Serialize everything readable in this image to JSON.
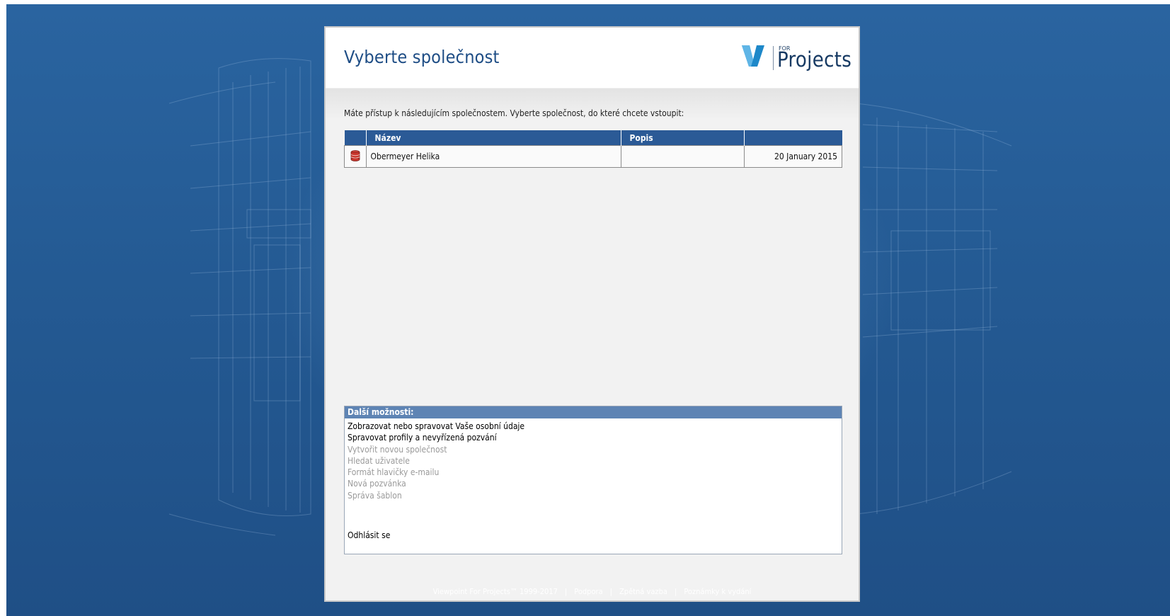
{
  "header": {
    "title": "Vyberte společnost",
    "logo": {
      "for_text": "FOR",
      "word": "Projects",
      "mark_color": "#1e88c9",
      "mark_accent": "#9fd0ee"
    }
  },
  "intro_text": "Máte přístup k následujícím společnostem. Vyberte společnost, do které chcete vstoupit:",
  "companies_table": {
    "columns": [
      "",
      "Název",
      "Popis",
      ""
    ],
    "rows": [
      {
        "icon": "database-icon",
        "name": "Obermeyer Helika",
        "description": "",
        "date": "20 January 2015"
      }
    ]
  },
  "more_options": {
    "title": "Další možnosti:",
    "items": [
      {
        "label": "Zobrazovat nebo spravovat Vaše osobní údaje",
        "enabled": true
      },
      {
        "label": "Spravovat profily a nevyřízená pozvání",
        "enabled": true
      },
      {
        "label": "Vytvořit novou společnost",
        "enabled": false
      },
      {
        "label": "Hledat uživatele",
        "enabled": false
      },
      {
        "label": "Formát hlavičky e-mailu",
        "enabled": false
      },
      {
        "label": "Nová pozvánka",
        "enabled": false
      },
      {
        "label": "Správa šablon",
        "enabled": false
      }
    ],
    "logout": "Odhlásit se"
  },
  "footer": {
    "copyright": "Viewpoint For Projects™ 1999-2017",
    "sep": "|",
    "links": [
      "Podpora",
      "Zpětná vazba",
      "Poznámky k vydání"
    ]
  },
  "colors": {
    "title": "#1e4d85",
    "table_header": "#2b5a96",
    "options_header": "#5e84b4",
    "background": "#245a93"
  }
}
